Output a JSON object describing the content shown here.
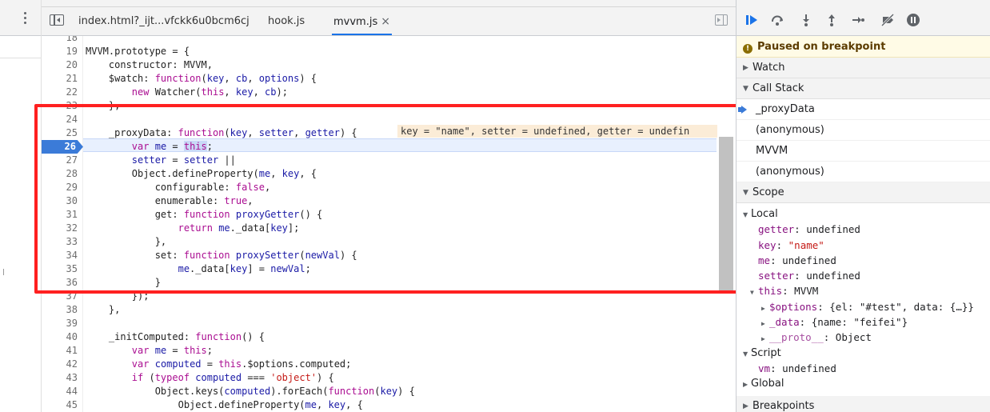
{
  "tabs": [
    {
      "label": "index.html?_ijt...vfckk6u0bcm6cj",
      "active": false
    },
    {
      "label": "hook.js",
      "active": false
    },
    {
      "label": "mvvm.js",
      "active": true,
      "close": "×"
    }
  ],
  "editor": {
    "line_numbers": [
      "18",
      "19",
      "20",
      "21",
      "22",
      "23",
      "24",
      "25",
      "26",
      "27",
      "28",
      "29",
      "30",
      "31",
      "32",
      "33",
      "34",
      "35",
      "36",
      "37",
      "38",
      "39",
      "40",
      "41",
      "42",
      "43",
      "44",
      "45"
    ],
    "current_line": "26",
    "inline_value": "key = \"name\", setter = undefined, getter = undefin"
  },
  "debugger": {
    "paused_text": "Paused on breakpoint",
    "sections": {
      "watch": "Watch",
      "call_stack": "Call Stack",
      "scope": "Scope",
      "breakpoints": "Breakpoints"
    },
    "call_stack": [
      "_proxyData",
      "(anonymous)",
      "MVVM",
      "(anonymous)"
    ],
    "scope": {
      "local_label": "Local",
      "getter": {
        "key": "getter",
        "value": "undefined"
      },
      "key": {
        "key": "key",
        "value": "\"name\""
      },
      "me": {
        "key": "me",
        "value": "undefined"
      },
      "setter": {
        "key": "setter",
        "value": "undefined"
      },
      "this": {
        "key": "this",
        "value": "MVVM"
      },
      "options": {
        "key": "$options",
        "value": "{el: \"#test\", data: {…}}"
      },
      "data": {
        "key": "_data",
        "value": "{name: \"feifei\"}"
      },
      "proto": {
        "key": "__proto__",
        "value": "Object"
      },
      "script_label": "Script",
      "vm": {
        "key": "vm",
        "value": "undefined"
      },
      "global_label": "Global"
    }
  },
  "colors": {
    "accent": "#1a73e8",
    "breakpoint": "#3b7bd8",
    "annotation": "#ff2020"
  }
}
